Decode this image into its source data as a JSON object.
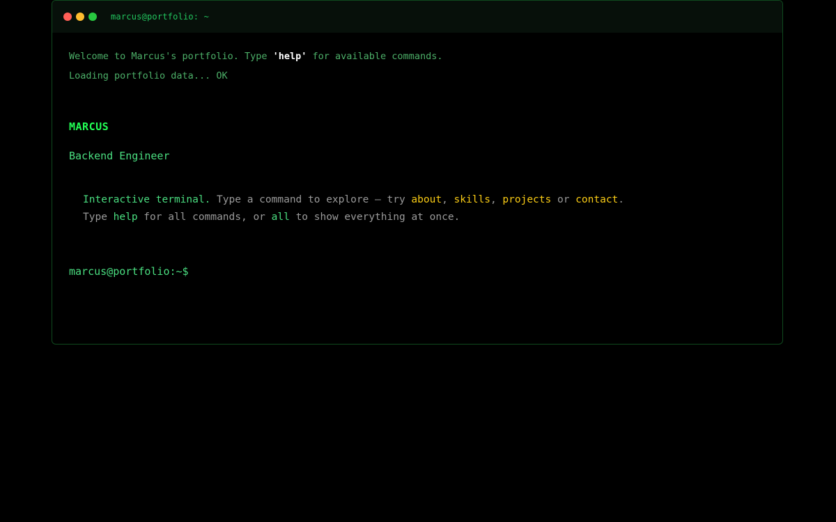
{
  "window": {
    "title": "marcus@portfolio: ~"
  },
  "boot": {
    "welcome_prefix": "Welcome to Marcus's portfolio. Type ",
    "welcome_cmd": "'help'",
    "welcome_suffix": " for available commands.",
    "loading_text": "Loading portfolio data",
    "loading_dots": "...",
    "loading_status": " OK"
  },
  "profile": {
    "name": "MARCUS",
    "role": "Backend Engineer"
  },
  "hint": {
    "line1_lead": "Interactive terminal.",
    "line1_text": " Type a command to explore — try ",
    "cmd_about": "about",
    "sep1": ", ",
    "cmd_skills": "skills",
    "sep2": ", ",
    "cmd_projects": "projects",
    "sep3": " or ",
    "cmd_contact": "contact",
    "end1": ".",
    "line2_prefix": "Type ",
    "cmd_help": "help",
    "line2_mid": " for all commands, or ",
    "cmd_all": "all",
    "line2_suffix": " to show everything at once."
  },
  "prompt": {
    "text": "marcus@portfolio:~$"
  },
  "colors": {
    "primary_green": "#4ade80",
    "bright_green": "#22ff55",
    "highlight_yellow": "#facc15",
    "muted_gray": "#9a9a9a",
    "background": "#000000"
  }
}
